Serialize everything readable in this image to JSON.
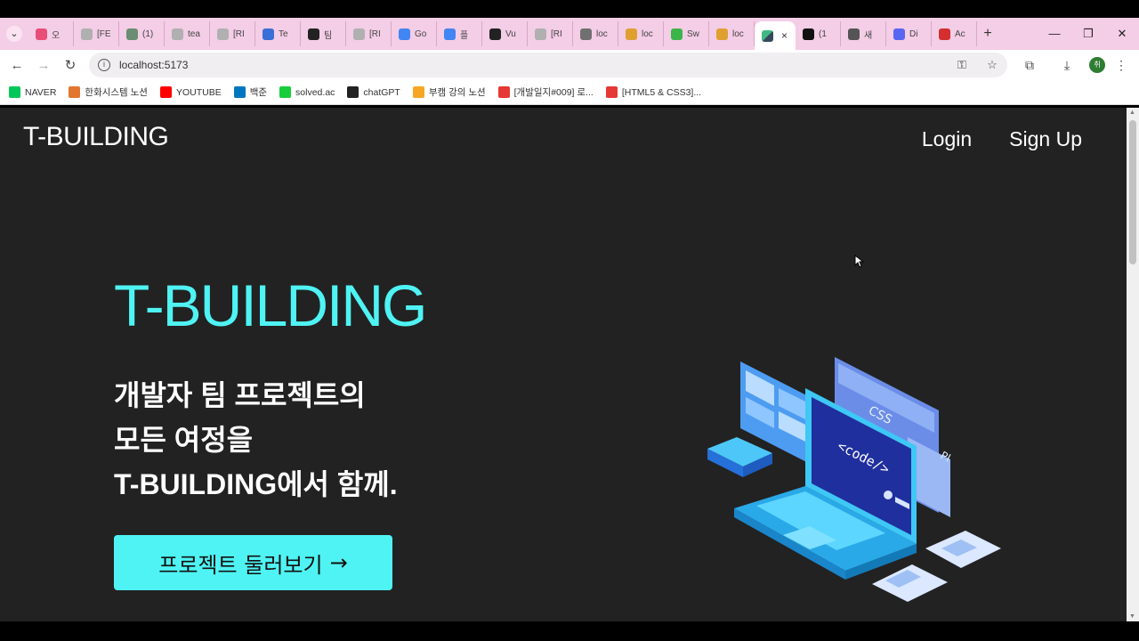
{
  "browser": {
    "tabs": [
      {
        "label": "오",
        "color": "#e94e77"
      },
      {
        "label": "[FE",
        "color": "#b0b0b0"
      },
      {
        "label": "(1)",
        "color": "#6a8d73"
      },
      {
        "label": "tea",
        "color": "#b0b0b0"
      },
      {
        "label": "[RI",
        "color": "#b0b0b0"
      },
      {
        "label": "Te",
        "color": "#3a6fd8"
      },
      {
        "label": "팀",
        "color": "#222222"
      },
      {
        "label": "[RI",
        "color": "#b0b0b0"
      },
      {
        "label": "Go",
        "color": "#4285f4"
      },
      {
        "label": "플",
        "color": "#4285f4"
      },
      {
        "label": "Vu",
        "color": "#222222"
      },
      {
        "label": "[RI",
        "color": "#b0b0b0"
      },
      {
        "label": "loc",
        "color": "#707070"
      },
      {
        "label": "loc",
        "color": "#e0a030"
      },
      {
        "label": "Sw",
        "color": "#3bb54a"
      },
      {
        "label": "loc",
        "color": "#e0a030"
      }
    ],
    "active_tab_close": "×",
    "tabs_after": [
      {
        "label": "(1",
        "color": "#111111"
      },
      {
        "label": "새",
        "color": "#555555"
      },
      {
        "label": "Di",
        "color": "#5865f2"
      },
      {
        "label": "Ac",
        "color": "#d32f2f"
      }
    ],
    "new_tab": "+",
    "url": "localhost:5173",
    "profile_initial": "취",
    "bookmarks": [
      {
        "label": "NAVER",
        "color": "#03c75a"
      },
      {
        "label": "한화시스템 노션",
        "color": "#e2762e"
      },
      {
        "label": "YOUTUBE",
        "color": "#ff0000"
      },
      {
        "label": "백준",
        "color": "#0076c0"
      },
      {
        "label": "solved.ac",
        "color": "#17ce3a"
      },
      {
        "label": "chatGPT",
        "color": "#222222"
      },
      {
        "label": "부캠 강의 노션",
        "color": "#f5a623"
      },
      {
        "label": "[개발일지#009] 로...",
        "color": "#e53935"
      },
      {
        "label": "[HTML5 & CSS3]...",
        "color": "#e53935"
      }
    ]
  },
  "site": {
    "logo": "T-BUILDING",
    "nav": {
      "login": "Login",
      "signup": "Sign Up"
    },
    "hero": {
      "title": "T-BUILDING",
      "line1": "개발자 팀 프로젝트의",
      "line2": "모든 여정을",
      "line3": "T-BUILDING에서 함께.",
      "cta": "프로젝트 둘러보기",
      "cta_arrow": "→"
    },
    "illustration": {
      "code_label": "<code/>",
      "css_label": "CSS",
      "side_label": "PI"
    },
    "colors": {
      "accent": "#4ff3f3",
      "background": "#222222",
      "text": "#ffffff"
    }
  }
}
